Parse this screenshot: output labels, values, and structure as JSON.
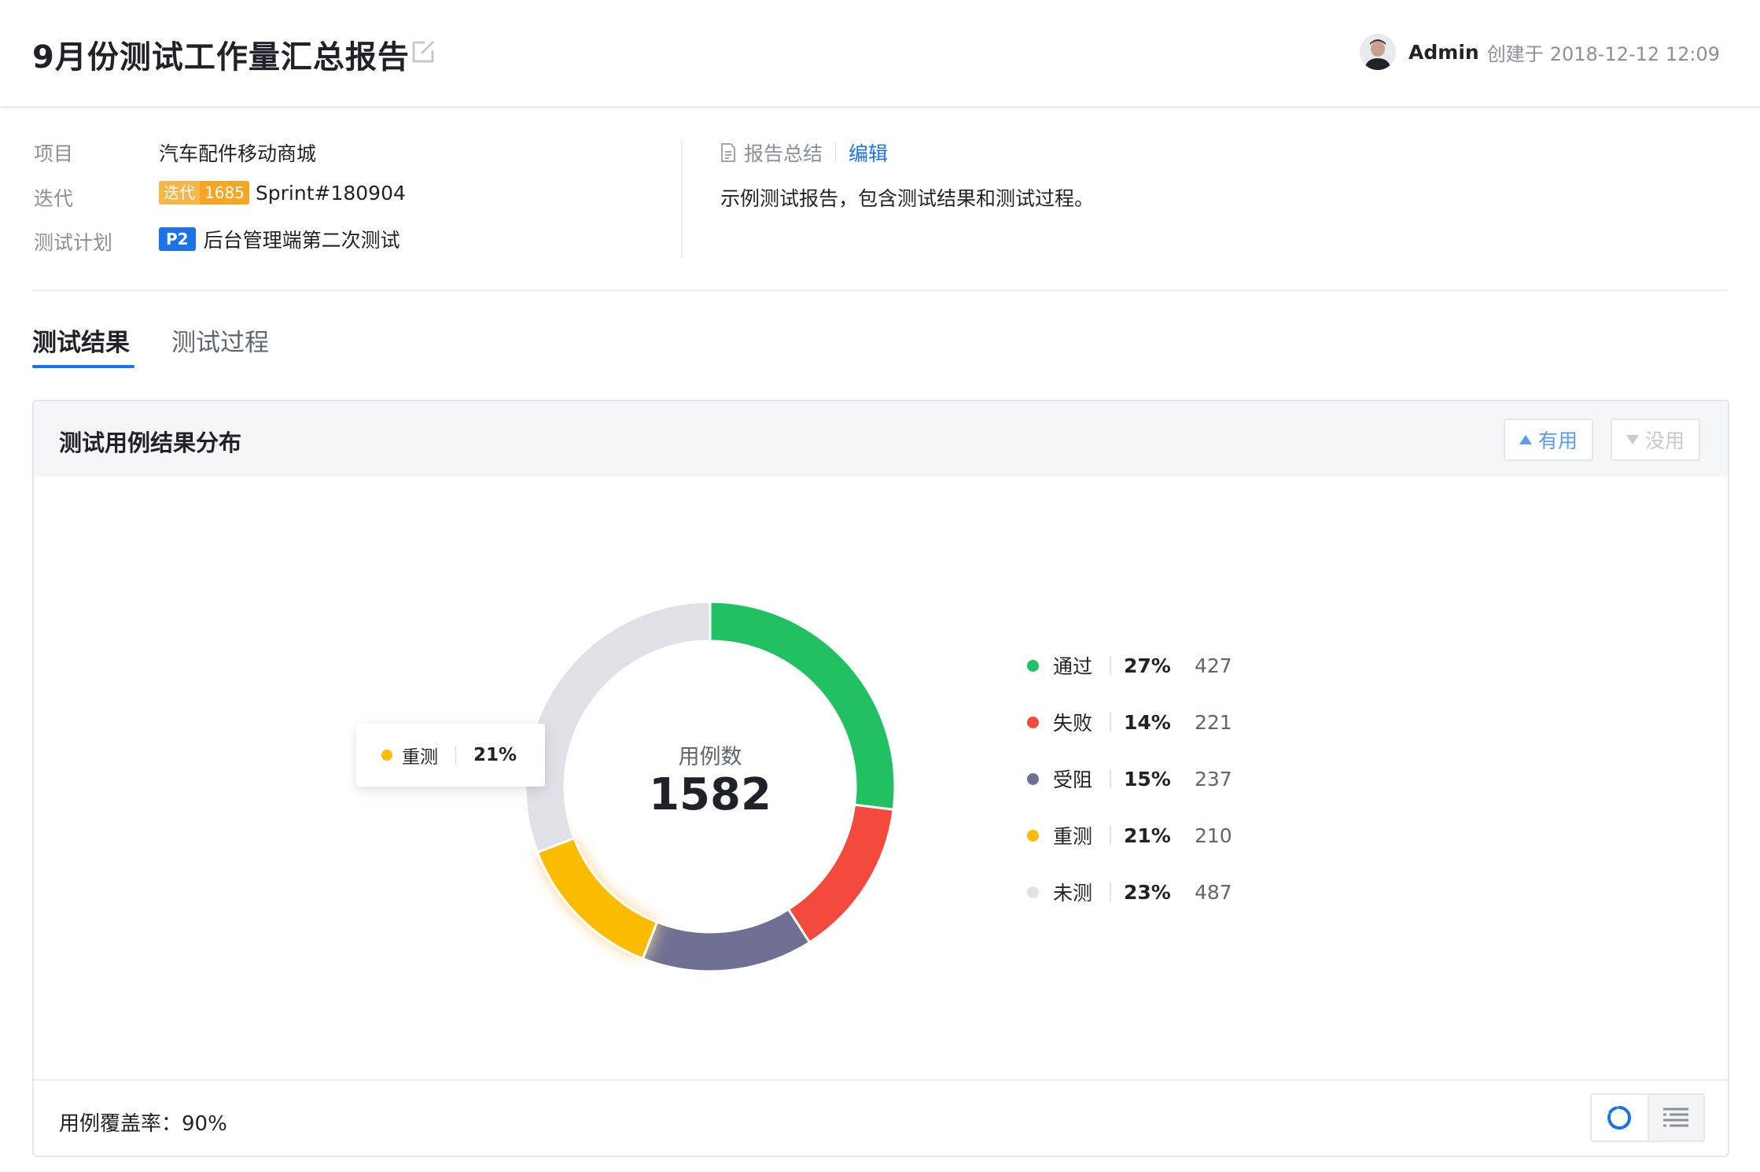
{
  "header": {
    "title": "9月份测试工作量汇总报告",
    "creator_name": "Admin",
    "created_label": "创建于",
    "created_time": "2018-12-12 12:09"
  },
  "info": {
    "project_label": "项目",
    "project_value": "汽车配件移动商城",
    "iteration_label": "迭代",
    "iteration_tag": "迭代",
    "iteration_id": "1685",
    "iteration_name": "Sprint#180904",
    "plan_label": "测试计划",
    "plan_priority": "P2",
    "plan_name": "后台管理端第二次测试"
  },
  "summary": {
    "label": "报告总结",
    "edit_label": "编辑",
    "text": "示例测试报告，包含测试结果和测试过程。"
  },
  "tabs": [
    {
      "label": "测试结果",
      "active": true
    },
    {
      "label": "测试过程",
      "active": false
    }
  ],
  "card": {
    "title": "测试用例结果分布",
    "useful_label": "有用",
    "useless_label": "没用",
    "coverage_label": "用例覆盖率：90%"
  },
  "tooltip": {
    "name": "重测",
    "pct": "21%",
    "color": "#fbbc05"
  },
  "chart_data": {
    "type": "pie",
    "center_label": "用例数",
    "total": "1582",
    "series": [
      {
        "name": "通过",
        "pct": "27%",
        "count": "427",
        "color": "#21c063"
      },
      {
        "name": "失败",
        "pct": "14%",
        "count": "221",
        "color": "#f4493d"
      },
      {
        "name": "受阻",
        "pct": "15%",
        "count": "237",
        "color": "#6e6f93"
      },
      {
        "name": "重测",
        "pct": "21%",
        "count": "210",
        "color": "#fbbc05"
      },
      {
        "name": "未测",
        "pct": "23%",
        "count": "487",
        "color": "#dfe1e6"
      }
    ]
  }
}
